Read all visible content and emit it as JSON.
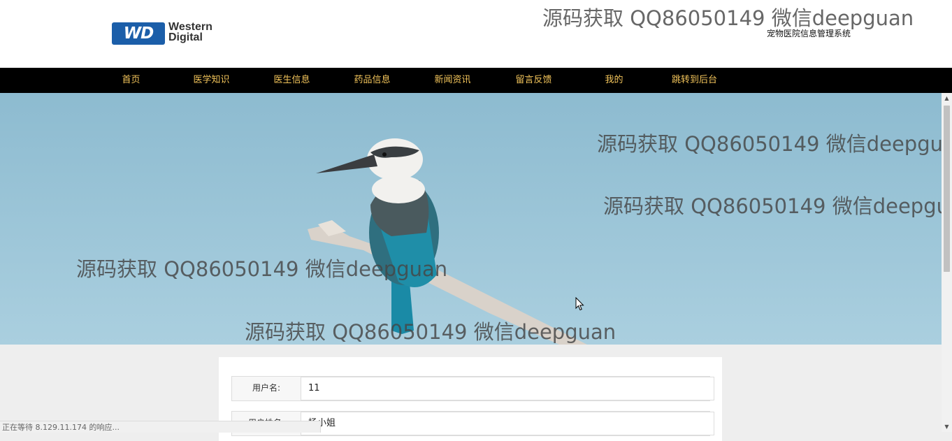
{
  "header": {
    "logo": {
      "line1": "Western",
      "line2": "Digital",
      "mark": "WD"
    },
    "subtitle": "宠物医院信息管理系统"
  },
  "nav": {
    "items": [
      {
        "label": "首页"
      },
      {
        "label": "医学知识"
      },
      {
        "label": "医生信息"
      },
      {
        "label": "药品信息"
      },
      {
        "label": "新闻资讯"
      },
      {
        "label": "留言反馈"
      },
      {
        "label": "我的"
      },
      {
        "label": "跳转到后台"
      }
    ]
  },
  "watermarks": [
    "源码获取 QQ86050149 微信deepguan",
    "源码获取 QQ86050149 微信deepgua",
    "源码获取 QQ86050149 微信deepgu",
    "源码获取 QQ86050149 微信deepguan",
    "源码获取 QQ86050149 微信deepguan"
  ],
  "form": {
    "username_label": "用户名:",
    "username_value": "11",
    "realname_label": "用户姓名:",
    "realname_value": "杨小姐"
  },
  "status": {
    "text": "正在等待 8.129.11.174 的响应..."
  },
  "colors": {
    "nav_bg": "#000000",
    "nav_text": "#f3c55b",
    "logo_blue": "#1b5ea9",
    "sky": "#9fc6d8"
  },
  "icons": {
    "cursor": "mouse-pointer-icon",
    "scroll_up": "chevron-up-icon",
    "scroll_down": "chevron-down-icon"
  }
}
